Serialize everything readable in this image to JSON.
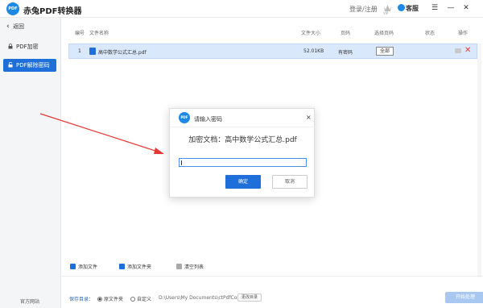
{
  "app": {
    "logo_text": "PDF",
    "title": "赤兔PDF转换器"
  },
  "header": {
    "login_label": "登录/注册",
    "vip_badge": "VIP",
    "service_label": "客服"
  },
  "window_controls": {
    "menu": "☰",
    "minimize": "—",
    "close": "✕"
  },
  "sidebar": {
    "back_label": "返回",
    "items": [
      {
        "label": "PDF加密",
        "active": false
      },
      {
        "label": "PDF解除密码",
        "active": true
      }
    ],
    "official_site": "官方网站"
  },
  "table": {
    "headers": {
      "no": "编号",
      "name": "文件名称",
      "size": "文件大小",
      "pages": "页码",
      "select_pages": "选择页码",
      "status": "状态",
      "action": "操作"
    },
    "rows": [
      {
        "no": "1",
        "name": "高中数学公式汇总.pdf",
        "size": "52.01KB",
        "pages": "有密码",
        "select_pages": "全部",
        "status": ""
      }
    ]
  },
  "toolbar": {
    "add_file": "添加文件",
    "add_folder": "添加文件夹",
    "clear_list": "清空列表"
  },
  "footer": {
    "save_dir_label": "保存目录：",
    "option_source": "原文件夹",
    "option_custom": "自定义",
    "path": "D:\\Users\\My Documents\\ctPdfCon",
    "change_dir": "更改目录",
    "start_button": "开始处理"
  },
  "modal": {
    "logo_text": "PDF",
    "title": "请输入密码",
    "close": "×",
    "document_line": "加密文档：高中数学公式汇总.pdf",
    "password_value": "",
    "ok_label": "确定",
    "cancel_label": "取消"
  },
  "colors": {
    "accent": "#1e6fd9",
    "selected_row": "#d9e8fb",
    "annotation_arrow": "#e53935",
    "delete": "#e53935"
  }
}
